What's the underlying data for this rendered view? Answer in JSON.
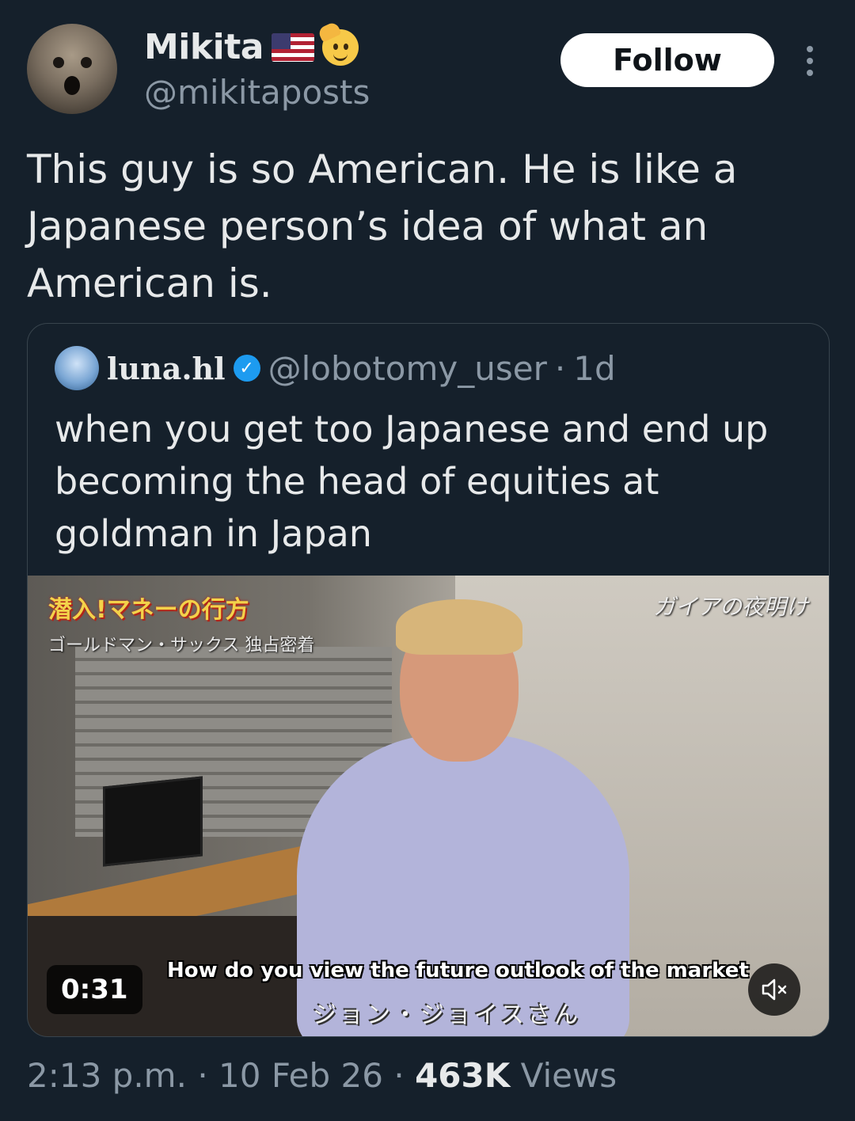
{
  "author": {
    "display_name": "Mikita",
    "handle": "@mikitaposts",
    "follow_label": "Follow"
  },
  "tweet": {
    "text": "This guy is so American. He is like a Japanese person’s idea of what an American is."
  },
  "quoted": {
    "display_name": "luna.hl",
    "handle": "@lobotomy_user",
    "separator": "·",
    "time": "1d",
    "text": "when you get too Japanese and end up becoming the head of equities at goldman in Japan",
    "video": {
      "overlay_title": "潜入!マネーの行方",
      "overlay_subtitle": "ゴールドマン・サックス 独占密着",
      "overlay_logo": "ガイアの夜明け",
      "caption_en": "How do you view the future outlook of the market",
      "caption_jp": "ジョン・ジョイスさん",
      "duration": "0:31"
    }
  },
  "meta": {
    "time": "2:13 p.m.",
    "dot1": "·",
    "date": "10 Feb 26",
    "dot2": "·",
    "views_count": "463K",
    "views_label": "Views"
  },
  "colors": {
    "background": "#15202b",
    "text": "#e7e9ea",
    "muted": "#8b98a5",
    "verified": "#1d9bf0"
  }
}
